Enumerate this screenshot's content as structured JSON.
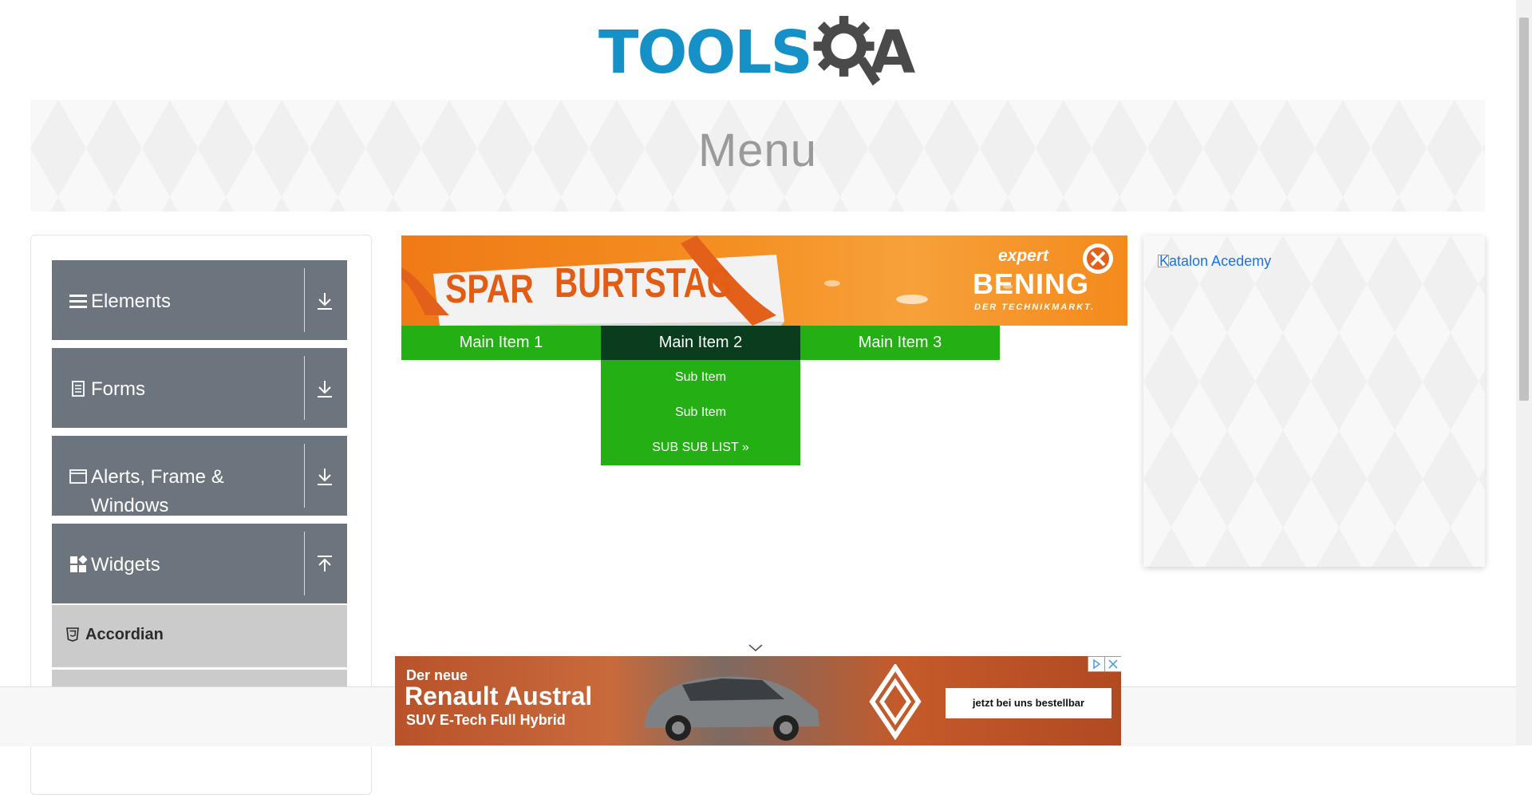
{
  "header": {
    "logo_text": "TOOLS",
    "logo_suffix": "A"
  },
  "banner": {
    "title": "Menu"
  },
  "sidebar": {
    "groups": [
      {
        "label": "Elements",
        "icon": "list-icon",
        "state": "collapsed"
      },
      {
        "label": "Forms",
        "icon": "document-icon",
        "state": "collapsed"
      },
      {
        "label": "Alerts, Frame & Windows",
        "icon": "window-icon",
        "state": "collapsed"
      },
      {
        "label": "Widgets",
        "icon": "widgets-icon",
        "state": "expanded"
      }
    ],
    "active_item": {
      "label": "Accordian",
      "icon": "html5-icon"
    }
  },
  "top_ad": {
    "headline_1": "SPAR",
    "headline_2": "BURTSTAG",
    "brand_top": "expert",
    "brand_name": "BENING",
    "brand_tagline": "DER TECHNIKMARKT."
  },
  "menu": {
    "items": [
      "Main Item 1",
      "Main Item 2",
      "Main Item 3"
    ],
    "active_index": 1,
    "submenu": [
      "Sub Item",
      "Sub Item",
      "SUB SUB LIST »"
    ]
  },
  "right_ad": {
    "alt_text": "Katalon Acedemy"
  },
  "bottom_ad": {
    "line_1": "Der neue",
    "line_2": "Renault Austral",
    "line_3": "SUV E-Tech Full Hybrid",
    "cta": "jetzt bei uns bestellbar"
  },
  "colors": {
    "menu_green": "#24af15",
    "menu_active": "#0a3d1e",
    "sidebar_group": "#6c757d",
    "logo_blue": "#1591c8"
  }
}
